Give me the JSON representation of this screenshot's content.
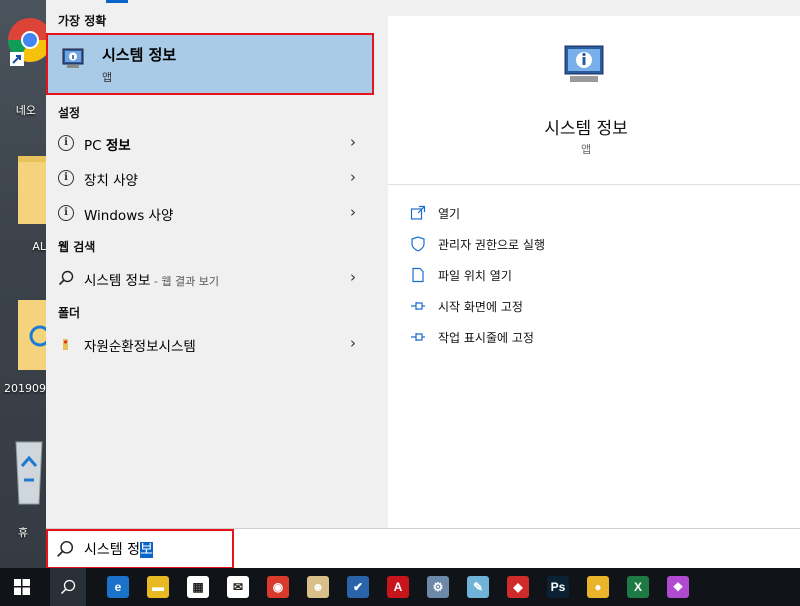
{
  "desktop": {
    "icons": [
      {
        "name": "chrome-icon",
        "label": "네오"
      },
      {
        "name": "folder-icon",
        "label": "AL"
      },
      {
        "name": "ie-folder-icon",
        "label": "201909"
      },
      {
        "name": "recycle-bin-icon",
        "label": "휴"
      }
    ]
  },
  "start": {
    "best_match_header": "가장 정확",
    "best_match": {
      "title": "시스템 정보",
      "subtitle": "앱"
    },
    "settings_header": "설정",
    "settings_items": [
      {
        "pre": "PC ",
        "bold": "정보",
        "post": ""
      },
      {
        "pre": "장치 사양",
        "bold": "",
        "post": ""
      },
      {
        "pre": "Windows 사양",
        "bold": "",
        "post": ""
      }
    ],
    "web_header": "웹 검색",
    "web_item": {
      "text": "시스템 정보",
      "suffix": " - 웹 결과 보기"
    },
    "folder_header": "폴더",
    "folder_item": {
      "text": "자원순환정보시스템"
    },
    "chevron": "›"
  },
  "detail": {
    "title": "시스템 정보",
    "subtitle": "앱",
    "actions": [
      {
        "icon": "open-icon",
        "label": "열기"
      },
      {
        "icon": "shield-icon",
        "label": "관리자 권한으로 실행"
      },
      {
        "icon": "file-location-icon",
        "label": "파일 위치 열기"
      },
      {
        "icon": "pin-start-icon",
        "label": "시작 화면에 고정"
      },
      {
        "icon": "pin-taskbar-icon",
        "label": "작업 표시줄에 고정"
      }
    ]
  },
  "search": {
    "typed": "시스템 정",
    "selected": "보"
  },
  "taskbar": {
    "items": [
      {
        "name": "start-button",
        "glyph": "⊞",
        "bg": "#101418"
      },
      {
        "name": "search-button",
        "glyph": "⚲",
        "bg": "#2a3038"
      },
      {
        "name": "edge-icon",
        "glyph": "e",
        "bg": "#1a73c8"
      },
      {
        "name": "file-explorer-icon",
        "glyph": "▬",
        "bg": "#e8b923"
      },
      {
        "name": "store-icon",
        "glyph": "▦",
        "bg": "#ffffff"
      },
      {
        "name": "mail-icon",
        "glyph": "✉",
        "bg": "#ffffff"
      },
      {
        "name": "app-red-icon",
        "glyph": "◉",
        "bg": "#d83a2b"
      },
      {
        "name": "app-figure-icon",
        "glyph": "☻",
        "bg": "#d9c08a"
      },
      {
        "name": "app-check-icon",
        "glyph": "✔",
        "bg": "#2a64a8"
      },
      {
        "name": "autocad-icon",
        "glyph": "A",
        "bg": "#c8151b"
      },
      {
        "name": "app-gear-icon",
        "glyph": "⚙",
        "bg": "#6c8aa8"
      },
      {
        "name": "app-pencil-icon",
        "glyph": "✎",
        "bg": "#6fb3d8"
      },
      {
        "name": "app-red2-icon",
        "glyph": "◆",
        "bg": "#cf2b2b"
      },
      {
        "name": "photoshop-icon",
        "glyph": "Ps",
        "bg": "#0b2235"
      },
      {
        "name": "chrome-task-icon",
        "glyph": "●",
        "bg": "#e9b32a"
      },
      {
        "name": "excel-icon",
        "glyph": "X",
        "bg": "#1e7a45"
      },
      {
        "name": "app-ribbon-icon",
        "glyph": "❖",
        "bg": "#b04ad0"
      }
    ]
  }
}
